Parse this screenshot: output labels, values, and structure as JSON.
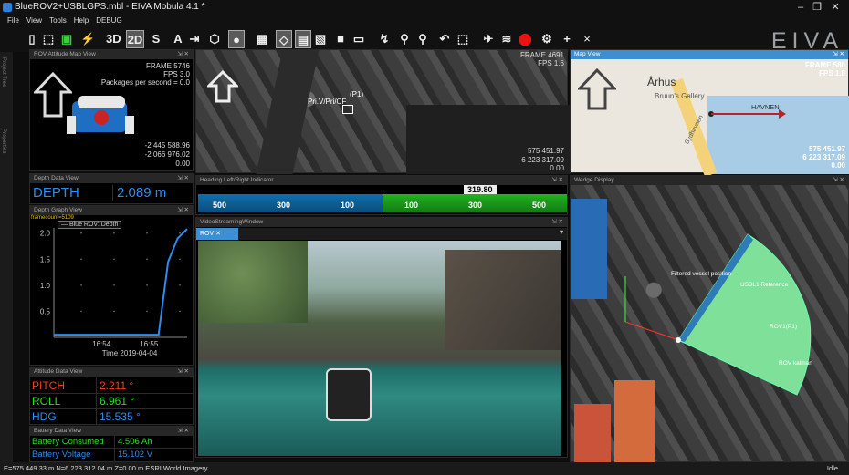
{
  "window": {
    "title": "BlueROV2+USBLGPS.mbl - EIVA Mobula 4.1 *",
    "controls": [
      "minimize",
      "restore",
      "close"
    ]
  },
  "menu": [
    "File",
    "View",
    "Tools",
    "Help",
    "DEBUG"
  ],
  "toolbar": {
    "btn_3d": "3D",
    "btn_2d": "2D",
    "btn_s": "S",
    "btn_a": "A",
    "brand": "EIVA"
  },
  "side_tabs": [
    "Project Tree",
    "Properties"
  ],
  "attitude_map": {
    "title": "ROV Attitude Map View",
    "frame": "FRAME 5746",
    "fps": "FPS 3.0",
    "packages": "Packages per second = 0.0",
    "e": "-2 445 588.96",
    "n": "-2 066 976.02",
    "z": "0.00"
  },
  "aerial_view": {
    "frame": "FRAME 4691",
    "fps": "FPS 1.6",
    "label1": "(P1)",
    "label2": "Pri.V/Pri/CF",
    "e": "575 451.97",
    "n": "6 223 317.09",
    "z": "0.00"
  },
  "map_view": {
    "title": "Map View",
    "frame": "FRAME 580",
    "fps": "FPS 1.8",
    "city": "Århus",
    "gallery": "Bruun's Gallery",
    "harbour": "HAVNEN",
    "street": "Sydhavnen",
    "e": "575 451.97",
    "n": "6 223 317.09",
    "z": "0.00"
  },
  "depth_view": {
    "title": "Depth Data View",
    "label": "DEPTH",
    "value": "2.089 m"
  },
  "depth_graph": {
    "title": "Depth Graph View",
    "framecount": "framecount=5109",
    "legend": "Blue ROV: Depth",
    "date": "Time 2019-04-04"
  },
  "chart_data": {
    "type": "line",
    "series": [
      {
        "name": "Blue ROV: Depth",
        "x": [
          "16:53.0",
          "16:54",
          "16:54.5",
          "16:55",
          "16:55.2",
          "16:55.4",
          "16:55.6",
          "16:55.8"
        ],
        "values": [
          0.05,
          0.05,
          0.05,
          0.05,
          0.05,
          1.45,
          1.9,
          2.08
        ]
      }
    ],
    "categories_shown": [
      "16:54",
      "16:55"
    ],
    "yticks": [
      "0.5",
      "1.0",
      "1.5",
      "2.0"
    ],
    "ylim": [
      0,
      2.1
    ],
    "xlabel": "Time 2019-04-04",
    "grid": "dots"
  },
  "attitude_data": {
    "title": "Attitude Data View",
    "rows": [
      {
        "k": "PITCH",
        "v": "2.211 °"
      },
      {
        "k": "ROLL",
        "v": "6.961 °"
      },
      {
        "k": "HDG",
        "v": "15.535 °"
      }
    ]
  },
  "battery_data": {
    "title": "Battery Data View",
    "rows": [
      {
        "k": "Battery Consumed",
        "v": "4.506 Ah"
      },
      {
        "k": "Battery Voltage",
        "v": "15.102 V"
      }
    ]
  },
  "heading": {
    "title": "Heading Left/Right Indicator",
    "value": "319.80",
    "ticks": [
      "500",
      "300",
      "100",
      "100",
      "300",
      "500"
    ]
  },
  "video": {
    "title": "VideoStreamingWindow",
    "tab": "ROV"
  },
  "wedge": {
    "title": "Wedge Display",
    "label1": "Filtered vessel position",
    "label2": "USBL1 Reference",
    "label3": "ROV1(P1)",
    "label4": "ROV kalman"
  },
  "status": {
    "left": "E=575 449.33 m N=6 223 312.04 m Z=0.00 m ESRI World Imagery",
    "right": "Idle"
  }
}
